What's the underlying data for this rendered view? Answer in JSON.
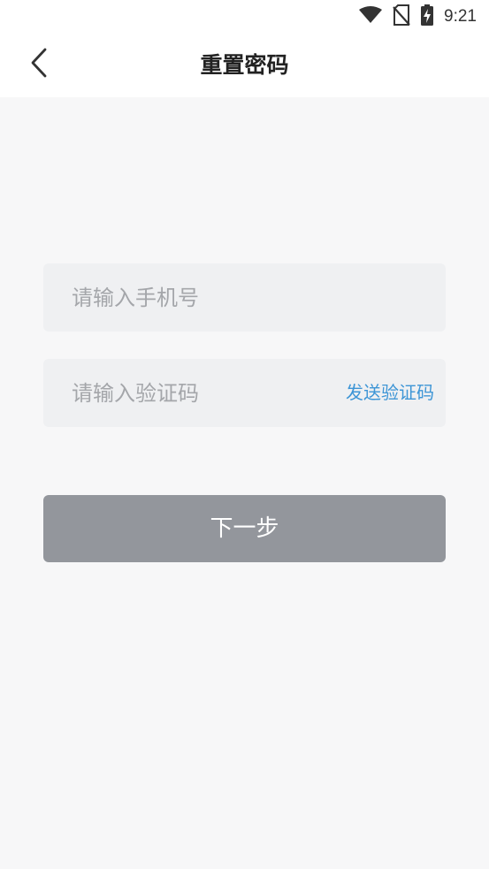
{
  "status_bar": {
    "time": "9:21",
    "icons": [
      "wifi-icon",
      "no-sim-icon",
      "battery-charging-icon"
    ]
  },
  "nav": {
    "title": "重置密码",
    "back_icon": "chevron-left-icon"
  },
  "form": {
    "phone": {
      "value": "",
      "placeholder": "请输入手机号"
    },
    "code": {
      "value": "",
      "placeholder": "请输入验证码",
      "send_label": "发送验证码"
    },
    "next_label": "下一步"
  },
  "colors": {
    "accent": "#3d95d6",
    "button_disabled": "#93969c",
    "page_background": "#f7f7f8",
    "field_background": "#eff0f2"
  }
}
